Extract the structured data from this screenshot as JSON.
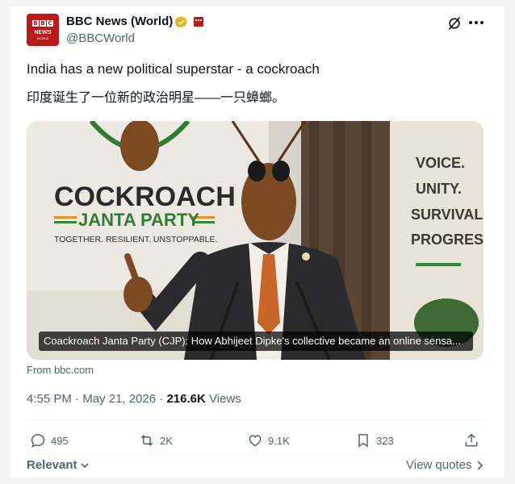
{
  "author": {
    "display_name": "BBC News (World)",
    "handle": "@BBCWorld",
    "avatar_top": "BBC",
    "avatar_mid": "NEWS",
    "avatar_bottom": "WORLD"
  },
  "tweet": {
    "text_en": "India has a new political superstar - a cockroach",
    "text_zh": "印度诞生了一位新的政治明星——一只蟑螂。"
  },
  "media": {
    "caption": "Coackroach Janta Party (CJP): How Abhijeet Dipke's collective became an online sensa...",
    "banner_line1": "COCKROACH",
    "banner_line2": "JANTA PARTY",
    "banner_tagline": "TOGETHER. RESILIENT. UNSTOPPABLE.",
    "wall_words": [
      "VOICE.",
      "UNITY.",
      "SURVIVAL.",
      "PROGRESS."
    ]
  },
  "source": "From bbc.com",
  "meta": {
    "time": "4:55 PM",
    "date": "May 21, 2026",
    "views_count": "216.6K",
    "views_label": "Views",
    "sep": "·"
  },
  "actions": {
    "replies": "495",
    "reposts": "2K",
    "likes": "9.1K",
    "bookmarks": "323"
  },
  "footer": {
    "sort_label": "Relevant",
    "view_quotes": "View quotes"
  },
  "colors": {
    "brand_red": "#bb1919",
    "verified_gold": "#e2b719",
    "text_primary": "#0f1419",
    "text_secondary": "#536471"
  },
  "icons": [
    "verified-badge-icon",
    "grok-icon",
    "more-icon",
    "reply-icon",
    "repost-icon",
    "like-icon",
    "bookmark-icon",
    "share-icon",
    "chevron-down-icon",
    "chevron-right-icon"
  ]
}
